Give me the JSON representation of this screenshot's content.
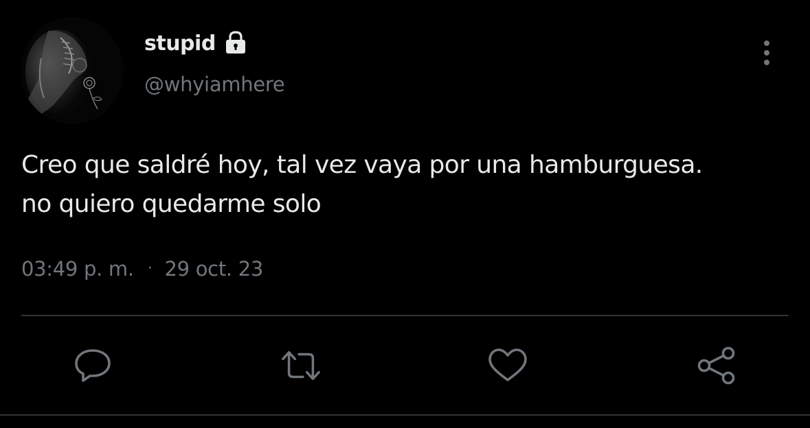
{
  "tweet": {
    "display_name": "stupid",
    "protected_icon": "lock-icon",
    "handle": "@whyiamhere",
    "text_lines": [
      "Creo que saldré hoy, tal vez vaya por una hamburguesa.",
      "no quiero quedarme solo"
    ],
    "time": "03:49 p. m.",
    "separator": "·",
    "date": "29 oct. 23"
  },
  "actions": {
    "reply_icon": "reply-icon",
    "retweet_icon": "retweet-icon",
    "like_icon": "heart-icon",
    "share_icon": "share-icon"
  },
  "menu_icon": "more-vertical-icon",
  "colors": {
    "background": "#000000",
    "primary_text": "#e7e9ea",
    "secondary_text": "#71767b",
    "divider": "#2f3336"
  }
}
